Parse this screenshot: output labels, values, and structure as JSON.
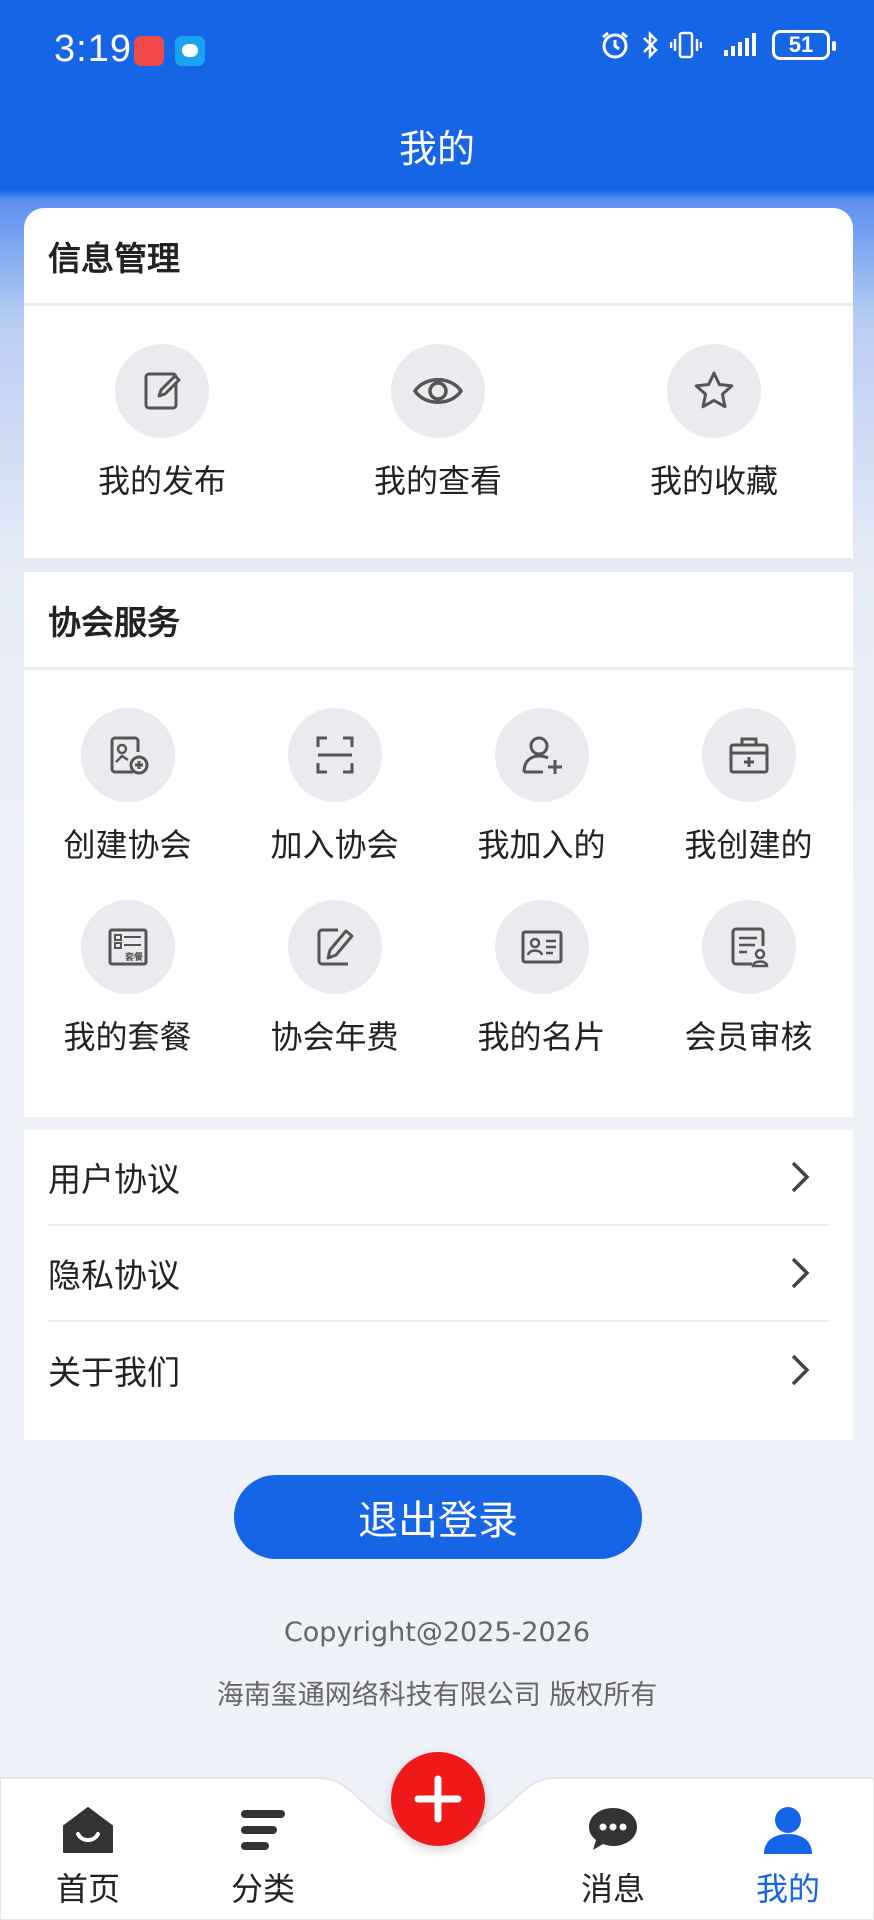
{
  "status_bar": {
    "time": "3:19",
    "battery": "51"
  },
  "header": {
    "title": "我的"
  },
  "info_section": {
    "title": "信息管理",
    "items": [
      {
        "label": "我的发布",
        "icon": "edit-icon"
      },
      {
        "label": "我的查看",
        "icon": "eye-icon"
      },
      {
        "label": "我的收藏",
        "icon": "star-icon"
      }
    ]
  },
  "assoc_section": {
    "title": "协会服务",
    "items": [
      {
        "label": "创建协会",
        "icon": "create-association-icon"
      },
      {
        "label": "加入协会",
        "icon": "scan-icon"
      },
      {
        "label": "我加入的",
        "icon": "user-add-icon"
      },
      {
        "label": "我创建的",
        "icon": "medkit-icon"
      },
      {
        "label": "我的套餐",
        "icon": "package-icon",
        "icon_text": "套餐"
      },
      {
        "label": "协会年费",
        "icon": "edit-icon"
      },
      {
        "label": "我的名片",
        "icon": "card-icon"
      },
      {
        "label": "会员审核",
        "icon": "review-icon"
      }
    ]
  },
  "links": [
    {
      "label": "用户协议"
    },
    {
      "label": "隐私协议"
    },
    {
      "label": "关于我们"
    }
  ],
  "logout_label": "退出登录",
  "footer": {
    "copyright": "Copyright@2025-2026",
    "company": "海南玺通网络科技有限公司 版权所有"
  },
  "bottom_nav": {
    "items": [
      {
        "label": "首页",
        "icon": "home-icon"
      },
      {
        "label": "分类",
        "icon": "category-icon"
      },
      {
        "label": "消息",
        "icon": "message-icon"
      },
      {
        "label": "我的",
        "icon": "profile-icon"
      }
    ],
    "active": "我的"
  },
  "colors": {
    "primary": "#1565e6",
    "fab": "#f01818",
    "icon_bg": "#eaebef",
    "icon_stroke": "#555555"
  }
}
